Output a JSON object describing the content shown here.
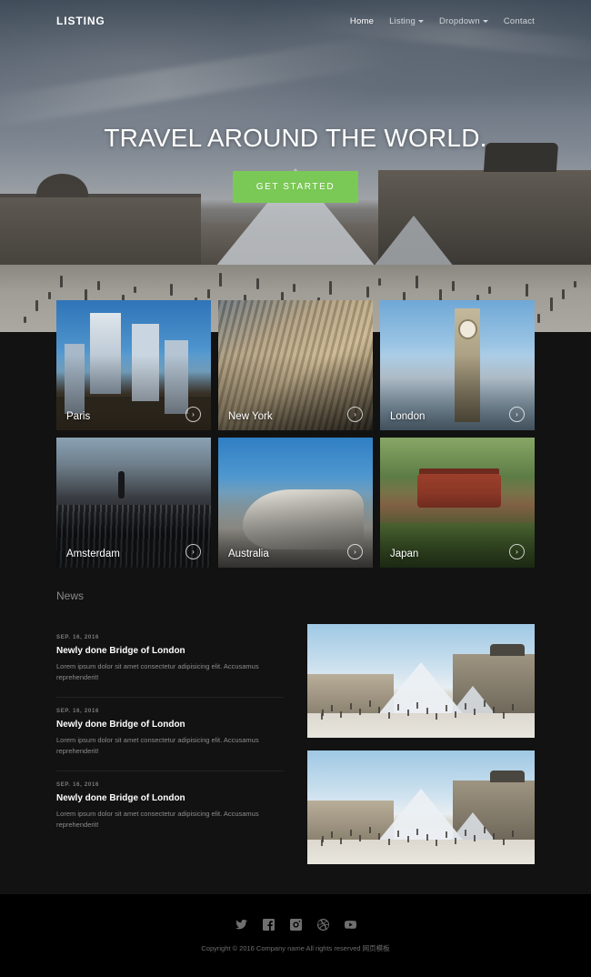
{
  "nav": {
    "logo": "LISTING",
    "links": [
      {
        "label": "Home",
        "active": true,
        "caret": false
      },
      {
        "label": "Listing",
        "active": false,
        "caret": true
      },
      {
        "label": "Dropdown",
        "active": false,
        "caret": true
      },
      {
        "label": "Contact",
        "active": false,
        "caret": false
      }
    ]
  },
  "hero": {
    "title": "TRAVEL AROUND THE WORLD.",
    "cta_label": "GET STARTED",
    "cta_color": "#7ac855"
  },
  "gallery": {
    "cards": [
      {
        "label": "Paris",
        "art": "la",
        "arrow": "›"
      },
      {
        "label": "New York",
        "art": "nyc",
        "arrow": "›"
      },
      {
        "label": "London",
        "art": "lon",
        "arrow": "›"
      },
      {
        "label": "Amsterdam",
        "art": "ams",
        "arrow": "›"
      },
      {
        "label": "Australia",
        "art": "aus",
        "arrow": "›"
      },
      {
        "label": "Japan",
        "art": "jpn",
        "arrow": "›"
      }
    ]
  },
  "news": {
    "heading": "News",
    "items": [
      {
        "date": "SEP. 16, 2016",
        "title": "Newly done Bridge of London",
        "text": "Lorem ipsum dolor sit amet consectetur adipisicing elit. Accusamus reprehenderit!"
      },
      {
        "date": "SEP. 16, 2016",
        "title": "Newly done Bridge of London",
        "text": "Lorem ipsum dolor sit amet consectetur adipisicing elit. Accusamus reprehenderit!"
      },
      {
        "date": "SEP. 16, 2016",
        "title": "Newly done Bridge of London",
        "text": "Lorem ipsum dolor sit amet consectetur adipisicing elit. Accusamus reprehenderit!"
      }
    ],
    "images": [
      {
        "alt": "louvre-pyramid-photo"
      },
      {
        "alt": "louvre-pyramid-photo"
      }
    ]
  },
  "footer": {
    "socials": [
      "twitter-icon",
      "facebook-icon",
      "instagram-icon",
      "dribbble-icon",
      "youtube-icon"
    ],
    "copyright": "Copyright © 2016 Company name All rights reserved 网页模板"
  },
  "colors": {
    "accent": "#7ac855",
    "dark_bg": "#121212",
    "footer_bg": "#000000"
  }
}
